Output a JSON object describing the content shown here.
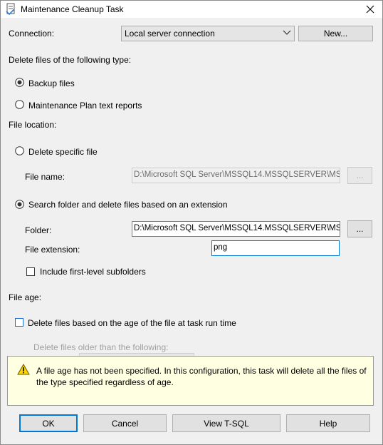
{
  "window": {
    "title": "Maintenance Cleanup Task",
    "close_glyph": "✕"
  },
  "connection": {
    "label": "Connection:",
    "selected": "Local server connection",
    "new_button": "New..."
  },
  "file_type": {
    "heading": "Delete files of the following type:",
    "options": [
      {
        "label": "Backup files",
        "selected": true
      },
      {
        "label": "Maintenance Plan text reports",
        "selected": false
      }
    ]
  },
  "file_location": {
    "heading": "File location:",
    "delete_specific": {
      "label": "Delete specific file",
      "selected": false
    },
    "file_name": {
      "label": "File name:",
      "value": "D:\\Microsoft SQL Server\\MSSQL14.MSSQLSERVER\\MSS(",
      "browse": "..."
    },
    "search_folder": {
      "label": "Search folder and delete files based on an extension",
      "selected": true
    },
    "folder": {
      "label": "Folder:",
      "value": "D:\\Microsoft SQL Server\\MSSQL14.MSSQLSERVER\\MSS(",
      "browse": "..."
    },
    "extension": {
      "label": "File extension:",
      "value": "png"
    },
    "include_subfolders": {
      "label": "Include first-level subfolders",
      "checked": false
    }
  },
  "file_age": {
    "heading": "File age:",
    "delete_by_age": {
      "label": "Delete files based on the age of the file at task run time",
      "checked": false
    },
    "older_than_label": "Delete files older than the following:"
  },
  "warning": {
    "icon": "warning-icon",
    "text": "A file age has not been specified. In this configuration, this task will delete all the files of the type specified regardless of age."
  },
  "buttons": {
    "ok": "OK",
    "cancel": "Cancel",
    "view_tsql": "View T-SQL",
    "help": "Help"
  },
  "colors": {
    "accent": "#0078d7",
    "dialog_bg": "#f0f0f0",
    "warning_bg": "#ffffe1"
  }
}
